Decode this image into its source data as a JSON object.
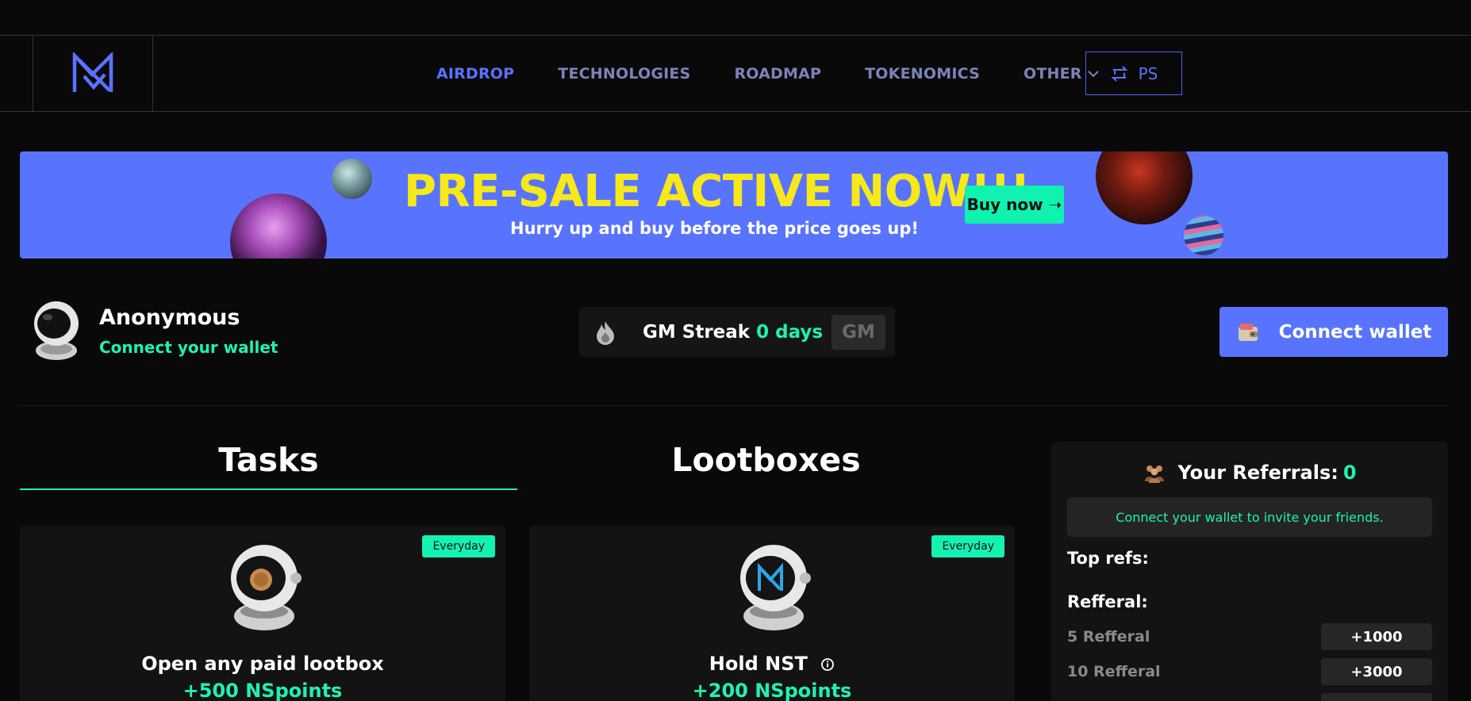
{
  "nav": {
    "items": [
      {
        "label": "AIRDROP",
        "active": true
      },
      {
        "label": "TECHNOLOGIES",
        "active": false
      },
      {
        "label": "ROADMAP",
        "active": false
      },
      {
        "label": "TOKENOMICS",
        "active": false
      },
      {
        "label": "OTHER",
        "active": false
      }
    ],
    "ps_label": "PS"
  },
  "banner": {
    "title": "PRE-SALE ACTIVE NOW!!!",
    "subtitle": "Hurry up and buy before the price goes up!",
    "buy_label": "Buy now ➝"
  },
  "user": {
    "name": "Anonymous",
    "sub": "Connect your wallet"
  },
  "streak": {
    "label": "GM Streak",
    "days": "0 days",
    "gm_label": "GM"
  },
  "connect": {
    "label": "Connect wallet"
  },
  "tabs": {
    "tasks": "Tasks",
    "lootboxes": "Lootboxes"
  },
  "cards": [
    {
      "badge": "Everyday",
      "title": "Open any paid lootbox",
      "points": "+500 NSpoints"
    },
    {
      "badge": "Everyday",
      "title": "Hold NST",
      "points": "+200 NSpoints"
    }
  ],
  "referrals": {
    "title": "Your Referrals:",
    "count": "0",
    "note": "Connect your wallet to invite your friends.",
    "top_label": "Top refs:",
    "ref_label": "Refferal:",
    "rows": [
      {
        "name": "5 Refferal",
        "value": "+1000"
      },
      {
        "name": "10 Refferal",
        "value": "+3000"
      }
    ]
  },
  "colors": {
    "accent_blue": "#5873fd",
    "accent_green": "#1ff2b0",
    "banner_yellow": "#f7e81a"
  }
}
